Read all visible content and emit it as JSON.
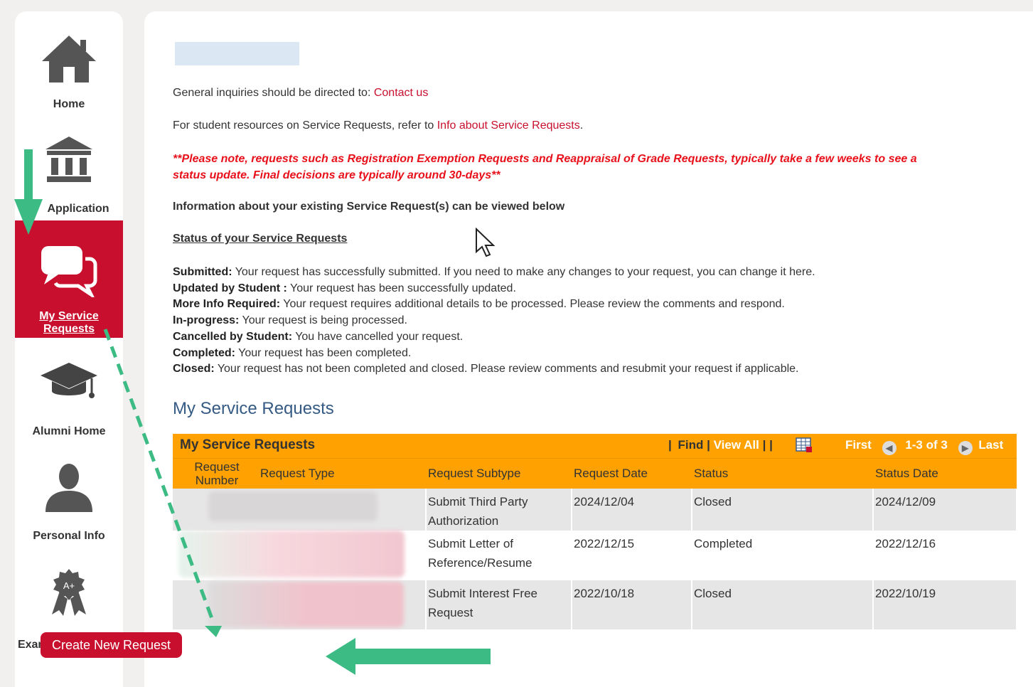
{
  "sidebar": {
    "items": [
      {
        "label": "Home",
        "icon": "home-icon"
      },
      {
        "label": "Application",
        "icon": "institution-icon"
      },
      {
        "label": "My Service Requests",
        "icon": "chat-bubbles-icon"
      },
      {
        "label": "Alumni Home",
        "icon": "graduation-cap-icon"
      },
      {
        "label": "Personal Info",
        "icon": "person-icon"
      },
      {
        "label": "Exams and Grades",
        "icon": "award-ribbon-icon"
      }
    ]
  },
  "main": {
    "inquiries_text": "General inquiries should be directed to: ",
    "contact_link": "Contact us",
    "resources_text": "For student resources on Service Requests, refer to ",
    "info_link": "Info about Service Requests",
    "resources_end": ".",
    "warning": "**Please note, requests such as Registration Exemption Requests and Reappraisal of Grade Requests, typically take a few weeks to see a status update. Final decisions are typically around 30-days**",
    "info_heading": "Information about your existing Service Request(s) can be viewed below",
    "status_heading": "Status of your Service Requests",
    "statuses": [
      {
        "term": "Submitted:",
        "desc": " Your request has successfully submitted. If you need to make any changes to your request, you can change it here."
      },
      {
        "term": "Updated by Student :",
        "desc": " Your request has been successfully updated."
      },
      {
        "term": "More Info Required:",
        "desc": " Your request requires additional details to be processed. Please review the comments and respond."
      },
      {
        "term": "In-progress:",
        "desc": " Your request is being processed."
      },
      {
        "term": "Cancelled by Student:",
        "desc": " You have cancelled your request."
      },
      {
        "term": "Completed:",
        "desc": " Your request has been completed."
      },
      {
        "term": "Closed:",
        "desc": " Your request has not been completed and closed. Please review comments and resubmit your request if applicable."
      }
    ],
    "section_title": "My Service Requests"
  },
  "grid": {
    "title": "My Service Requests",
    "nav": {
      "sep": "|",
      "find": "Find",
      "view_all": "View All",
      "first": "First",
      "range": "1-3 of 3",
      "last": "Last"
    },
    "columns": [
      "Request Number",
      "Request Type",
      "Request Subtype",
      "Request Date",
      "Status",
      "Status Date"
    ],
    "rows": [
      {
        "subtype": "Submit Third Party Authorization",
        "date": "2024/12/04",
        "status": "Closed",
        "status_date": "2024/12/09"
      },
      {
        "subtype": "Submit Letter of Reference/Resume",
        "date": "2022/12/15",
        "status": "Completed",
        "status_date": "2022/12/16"
      },
      {
        "subtype": "Submit Interest Free Request",
        "date": "2022/10/18",
        "status": "Closed",
        "status_date": "2022/10/19"
      }
    ]
  },
  "create_button": "Create New Request",
  "colors": {
    "accent_red": "#c8102e",
    "grid_orange": "#ffa100",
    "arrow_green": "#3dbb84",
    "title_blue": "#355a84"
  }
}
